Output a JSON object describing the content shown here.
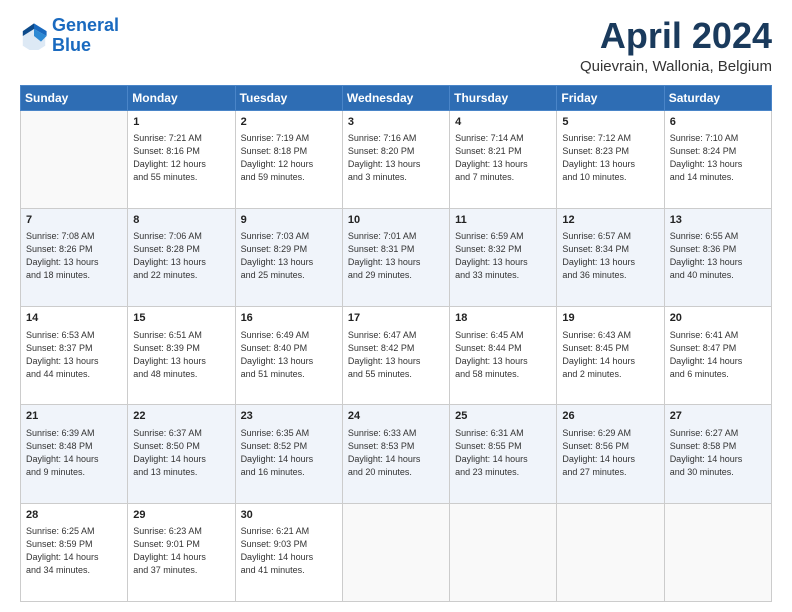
{
  "logo": {
    "line1": "General",
    "line2": "Blue"
  },
  "title": "April 2024",
  "subtitle": "Quievrain, Wallonia, Belgium",
  "weekdays": [
    "Sunday",
    "Monday",
    "Tuesday",
    "Wednesday",
    "Thursday",
    "Friday",
    "Saturday"
  ],
  "weeks": [
    [
      {
        "day": "",
        "info": ""
      },
      {
        "day": "1",
        "info": "Sunrise: 7:21 AM\nSunset: 8:16 PM\nDaylight: 12 hours\nand 55 minutes."
      },
      {
        "day": "2",
        "info": "Sunrise: 7:19 AM\nSunset: 8:18 PM\nDaylight: 12 hours\nand 59 minutes."
      },
      {
        "day": "3",
        "info": "Sunrise: 7:16 AM\nSunset: 8:20 PM\nDaylight: 13 hours\nand 3 minutes."
      },
      {
        "day": "4",
        "info": "Sunrise: 7:14 AM\nSunset: 8:21 PM\nDaylight: 13 hours\nand 7 minutes."
      },
      {
        "day": "5",
        "info": "Sunrise: 7:12 AM\nSunset: 8:23 PM\nDaylight: 13 hours\nand 10 minutes."
      },
      {
        "day": "6",
        "info": "Sunrise: 7:10 AM\nSunset: 8:24 PM\nDaylight: 13 hours\nand 14 minutes."
      }
    ],
    [
      {
        "day": "7",
        "info": "Sunrise: 7:08 AM\nSunset: 8:26 PM\nDaylight: 13 hours\nand 18 minutes."
      },
      {
        "day": "8",
        "info": "Sunrise: 7:06 AM\nSunset: 8:28 PM\nDaylight: 13 hours\nand 22 minutes."
      },
      {
        "day": "9",
        "info": "Sunrise: 7:03 AM\nSunset: 8:29 PM\nDaylight: 13 hours\nand 25 minutes."
      },
      {
        "day": "10",
        "info": "Sunrise: 7:01 AM\nSunset: 8:31 PM\nDaylight: 13 hours\nand 29 minutes."
      },
      {
        "day": "11",
        "info": "Sunrise: 6:59 AM\nSunset: 8:32 PM\nDaylight: 13 hours\nand 33 minutes."
      },
      {
        "day": "12",
        "info": "Sunrise: 6:57 AM\nSunset: 8:34 PM\nDaylight: 13 hours\nand 36 minutes."
      },
      {
        "day": "13",
        "info": "Sunrise: 6:55 AM\nSunset: 8:36 PM\nDaylight: 13 hours\nand 40 minutes."
      }
    ],
    [
      {
        "day": "14",
        "info": "Sunrise: 6:53 AM\nSunset: 8:37 PM\nDaylight: 13 hours\nand 44 minutes."
      },
      {
        "day": "15",
        "info": "Sunrise: 6:51 AM\nSunset: 8:39 PM\nDaylight: 13 hours\nand 48 minutes."
      },
      {
        "day": "16",
        "info": "Sunrise: 6:49 AM\nSunset: 8:40 PM\nDaylight: 13 hours\nand 51 minutes."
      },
      {
        "day": "17",
        "info": "Sunrise: 6:47 AM\nSunset: 8:42 PM\nDaylight: 13 hours\nand 55 minutes."
      },
      {
        "day": "18",
        "info": "Sunrise: 6:45 AM\nSunset: 8:44 PM\nDaylight: 13 hours\nand 58 minutes."
      },
      {
        "day": "19",
        "info": "Sunrise: 6:43 AM\nSunset: 8:45 PM\nDaylight: 14 hours\nand 2 minutes."
      },
      {
        "day": "20",
        "info": "Sunrise: 6:41 AM\nSunset: 8:47 PM\nDaylight: 14 hours\nand 6 minutes."
      }
    ],
    [
      {
        "day": "21",
        "info": "Sunrise: 6:39 AM\nSunset: 8:48 PM\nDaylight: 14 hours\nand 9 minutes."
      },
      {
        "day": "22",
        "info": "Sunrise: 6:37 AM\nSunset: 8:50 PM\nDaylight: 14 hours\nand 13 minutes."
      },
      {
        "day": "23",
        "info": "Sunrise: 6:35 AM\nSunset: 8:52 PM\nDaylight: 14 hours\nand 16 minutes."
      },
      {
        "day": "24",
        "info": "Sunrise: 6:33 AM\nSunset: 8:53 PM\nDaylight: 14 hours\nand 20 minutes."
      },
      {
        "day": "25",
        "info": "Sunrise: 6:31 AM\nSunset: 8:55 PM\nDaylight: 14 hours\nand 23 minutes."
      },
      {
        "day": "26",
        "info": "Sunrise: 6:29 AM\nSunset: 8:56 PM\nDaylight: 14 hours\nand 27 minutes."
      },
      {
        "day": "27",
        "info": "Sunrise: 6:27 AM\nSunset: 8:58 PM\nDaylight: 14 hours\nand 30 minutes."
      }
    ],
    [
      {
        "day": "28",
        "info": "Sunrise: 6:25 AM\nSunset: 8:59 PM\nDaylight: 14 hours\nand 34 minutes."
      },
      {
        "day": "29",
        "info": "Sunrise: 6:23 AM\nSunset: 9:01 PM\nDaylight: 14 hours\nand 37 minutes."
      },
      {
        "day": "30",
        "info": "Sunrise: 6:21 AM\nSunset: 9:03 PM\nDaylight: 14 hours\nand 41 minutes."
      },
      {
        "day": "",
        "info": ""
      },
      {
        "day": "",
        "info": ""
      },
      {
        "day": "",
        "info": ""
      },
      {
        "day": "",
        "info": ""
      }
    ]
  ]
}
